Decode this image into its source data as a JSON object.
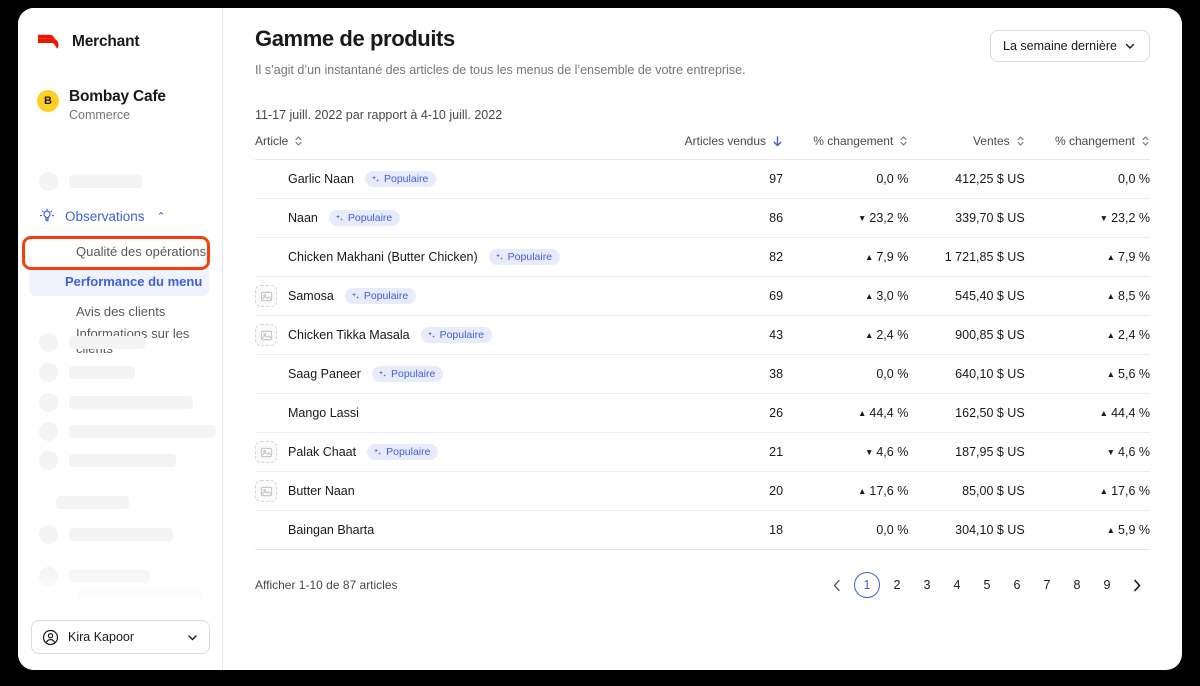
{
  "sidebar": {
    "brand": {
      "name": "Merchant",
      "logo_icon": "doordash-logo-icon"
    },
    "store": {
      "initial": "B",
      "name": "Bombay Cafe",
      "subtitle": "Commerce"
    },
    "nav_parent": {
      "label": "Observations",
      "icon": "lightbulb-icon",
      "caret": "⌃"
    },
    "nav_items": [
      {
        "label": "Qualité des opérations",
        "active": false
      },
      {
        "label": "Performance du menu",
        "active": true
      },
      {
        "label": "Avis des clients",
        "active": false
      },
      {
        "label": "Informations sur les clients",
        "active": false
      }
    ],
    "user": {
      "name": "Kira Kapoor",
      "icon": "account-circle-icon",
      "caret": "chevron-down-icon"
    }
  },
  "header": {
    "title": "Gamme de produits",
    "subtitle": "Il s’agit d’un instantané des articles de tous les menus de l’ensemble de votre entreprise.",
    "range_select": {
      "value": "La semaine dernière",
      "caret": "chevron-down-icon"
    }
  },
  "table": {
    "compare_line": "11-17 juill. 2022 par rapport à 4-10 juill. 2022",
    "columns": [
      {
        "label": "Article",
        "sort": "none",
        "align": "left"
      },
      {
        "label": "Articles vendus",
        "sort": "desc-active",
        "align": "right"
      },
      {
        "label": "% changement",
        "sort": "none",
        "align": "right"
      },
      {
        "label": "Ventes",
        "sort": "none",
        "align": "right"
      },
      {
        "label": "% changement",
        "sort": "none",
        "align": "right"
      }
    ],
    "badge_label": "Populaire",
    "rows": [
      {
        "name": "Garlic Naan",
        "badge": true,
        "thumb": "naan",
        "sold": "97",
        "sold_pct": "0,0 %",
        "sold_dir": "flat",
        "sales": "412,25 $ US",
        "sales_pct": "0,0 %",
        "sales_dir": "flat"
      },
      {
        "name": "Naan",
        "badge": true,
        "thumb": "naan2",
        "sold": "86",
        "sold_pct": "23,2 %",
        "sold_dir": "down",
        "sales": "339,70 $ US",
        "sales_pct": "23,2 %",
        "sales_dir": "down"
      },
      {
        "name": "Chicken Makhani (Butter Chicken)",
        "badge": true,
        "thumb": "curry",
        "sold": "82",
        "sold_pct": "7,9 %",
        "sold_dir": "up",
        "sales": "1 721,85 $ US",
        "sales_pct": "7,9 %",
        "sales_dir": "up"
      },
      {
        "name": "Samosa",
        "badge": true,
        "thumb": "placeholder",
        "sold": "69",
        "sold_pct": "3,0 %",
        "sold_dir": "up",
        "sales": "545,40 $ US",
        "sales_pct": "8,5 %",
        "sales_dir": "up"
      },
      {
        "name": "Chicken Tikka Masala",
        "badge": true,
        "thumb": "placeholder",
        "sold": "43",
        "sold_pct": "2,4 %",
        "sold_dir": "up",
        "sales": "900,85 $ US",
        "sales_pct": "2,4 %",
        "sales_dir": "up"
      },
      {
        "name": "Saag Paneer",
        "badge": true,
        "thumb": "paneer",
        "sold": "38",
        "sold_pct": "0,0 %",
        "sold_dir": "flat",
        "sales": "640,10 $ US",
        "sales_pct": "5,6 %",
        "sales_dir": "up"
      },
      {
        "name": "Mango Lassi",
        "badge": false,
        "thumb": "lassi",
        "sold": "26",
        "sold_pct": "44,4 %",
        "sold_dir": "up",
        "sales": "162,50 $ US",
        "sales_pct": "44,4 %",
        "sales_dir": "up"
      },
      {
        "name": "Palak Chaat",
        "badge": true,
        "thumb": "placeholder",
        "sold": "21",
        "sold_pct": "4,6 %",
        "sold_dir": "down",
        "sales": "187,95 $ US",
        "sales_pct": "4,6 %",
        "sales_dir": "down"
      },
      {
        "name": "Butter Naan",
        "badge": false,
        "thumb": "placeholder",
        "sold": "20",
        "sold_pct": "17,6 %",
        "sold_dir": "up",
        "sales": "85,00 $ US",
        "sales_pct": "17,6 %",
        "sales_dir": "up"
      },
      {
        "name": "Baingan Bharta",
        "badge": false,
        "thumb": "bharta",
        "sold": "18",
        "sold_pct": "0,0 %",
        "sold_dir": "flat",
        "sales": "304,10 $ US",
        "sales_pct": "5,9 %",
        "sales_dir": "up"
      }
    ],
    "footer_text": "Afficher 1-10 de 87 articles",
    "pages": [
      "1",
      "2",
      "3",
      "4",
      "5",
      "6",
      "7",
      "8",
      "9"
    ],
    "current_page": "1",
    "prev_icon": "chevron-left-icon",
    "next_icon": "chevron-right-icon"
  },
  "colors": {
    "accent_blue": "#3f5fe0",
    "brand_red": "#eb1700",
    "highlight_box": "#f4400f",
    "avatar_yellow": "#ffd024",
    "badge_bg": "#e8ebfc"
  }
}
